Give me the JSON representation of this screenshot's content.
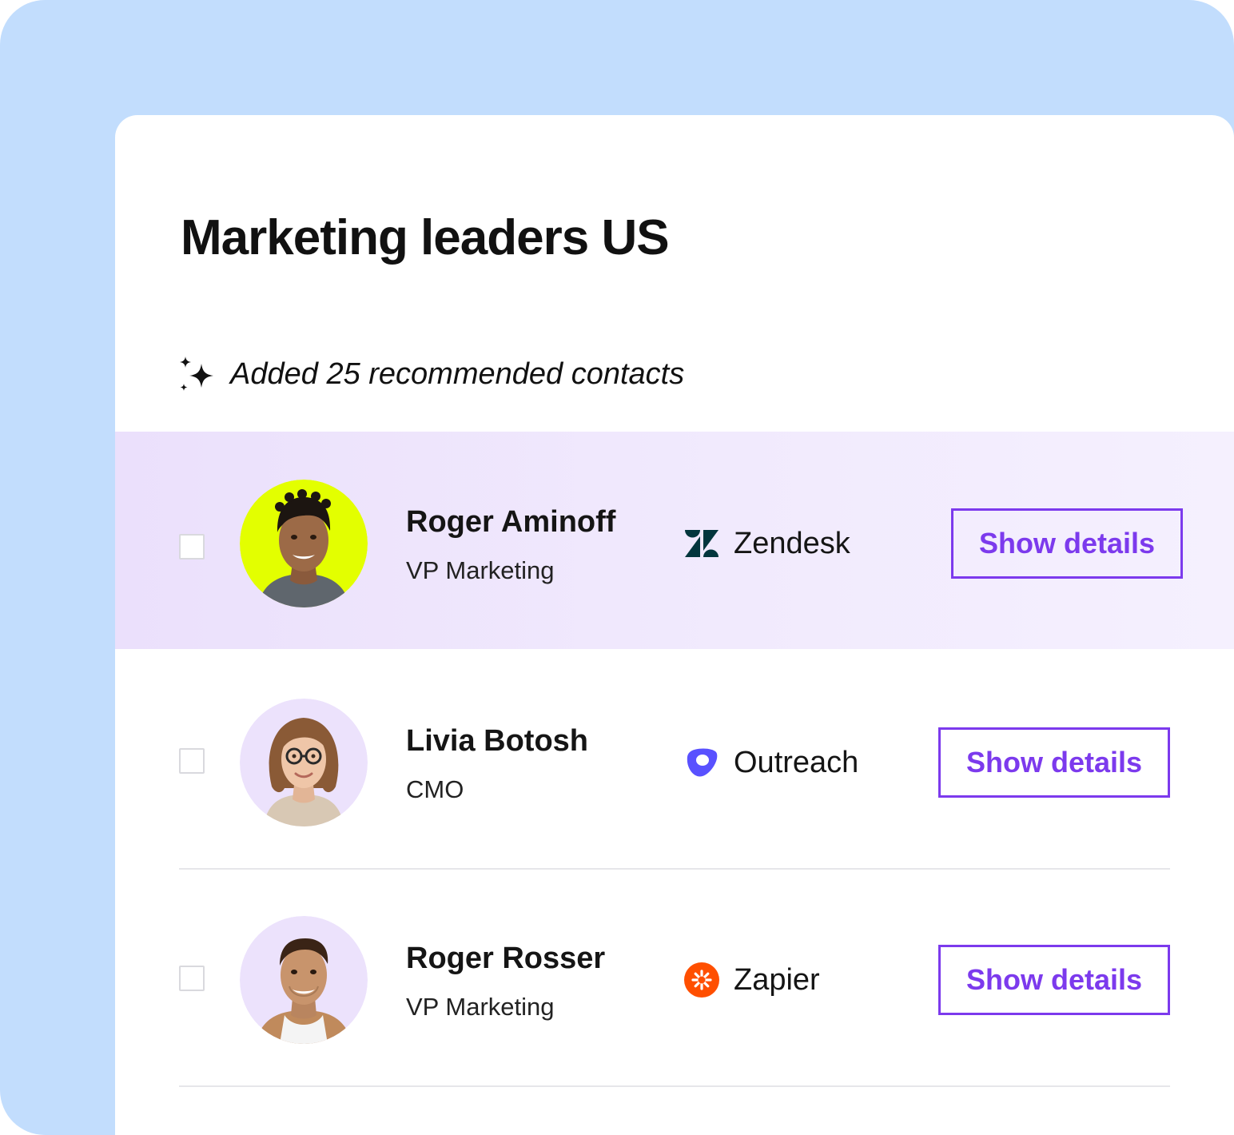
{
  "list": {
    "title": "Marketing leaders US",
    "recommendation_note": "Added 25 recommended contacts",
    "recommendation_icon": "sparkles-icon"
  },
  "contacts": [
    {
      "name": "Roger Aminoff",
      "role": "VP Marketing",
      "company": "Zendesk",
      "company_icon": "zendesk-logo-icon",
      "action_label": "Show details",
      "checked": false,
      "highlighted": true,
      "avatar_background": "#e3ff00"
    },
    {
      "name": "Livia Botosh",
      "role": "CMO",
      "company": "Outreach",
      "company_icon": "outreach-logo-icon",
      "action_label": "Show details",
      "checked": false,
      "highlighted": false,
      "avatar_background": "#ece2fc"
    },
    {
      "name": "Roger Rosser",
      "role": "VP Marketing",
      "company": "Zapier",
      "company_icon": "zapier-logo-icon",
      "action_label": "Show details",
      "checked": false,
      "highlighted": false,
      "avatar_background": "#ece2fc"
    }
  ],
  "colors": {
    "page_background": "#c2ddfd",
    "card_background": "#ffffff",
    "highlight_row": "#ede4fd",
    "accent": "#7c3aed",
    "zendesk": "#03363d",
    "outreach": "#5951ff",
    "zapier": "#ff4f00"
  }
}
